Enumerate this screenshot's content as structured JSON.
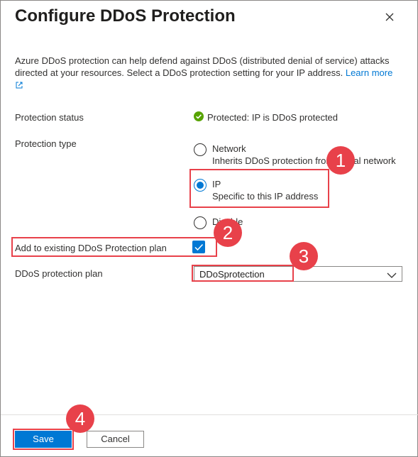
{
  "dialog": {
    "title": "Configure DDoS Protection",
    "description": "Azure DDoS protection can help defend against DDoS (distributed denial of service) attacks directed at your resources. Select a DDoS protection setting for your IP address.",
    "learn_more": "Learn more"
  },
  "protection_status": {
    "label": "Protection status",
    "value": "Protected: IP is DDoS protected"
  },
  "protection_type": {
    "label": "Protection type",
    "options": [
      {
        "label": "Network",
        "sublabel": "Inherits DDoS protection from virtual network",
        "selected": false
      },
      {
        "label": "IP",
        "sublabel": "Specific to this IP address",
        "selected": true
      },
      {
        "label": "Disable",
        "sublabel": "",
        "selected": false
      }
    ]
  },
  "add_to_plan": {
    "label": "Add to existing DDoS Protection plan",
    "checked": true
  },
  "ddos_plan": {
    "label": "DDoS protection plan",
    "value": "DDoSprotection"
  },
  "footer": {
    "save_label": "Save",
    "cancel_label": "Cancel"
  },
  "annotations": [
    "1",
    "2",
    "3",
    "4"
  ],
  "colors": {
    "accent": "#0078d4",
    "success": "#57a300",
    "highlight": "#e8414a"
  }
}
